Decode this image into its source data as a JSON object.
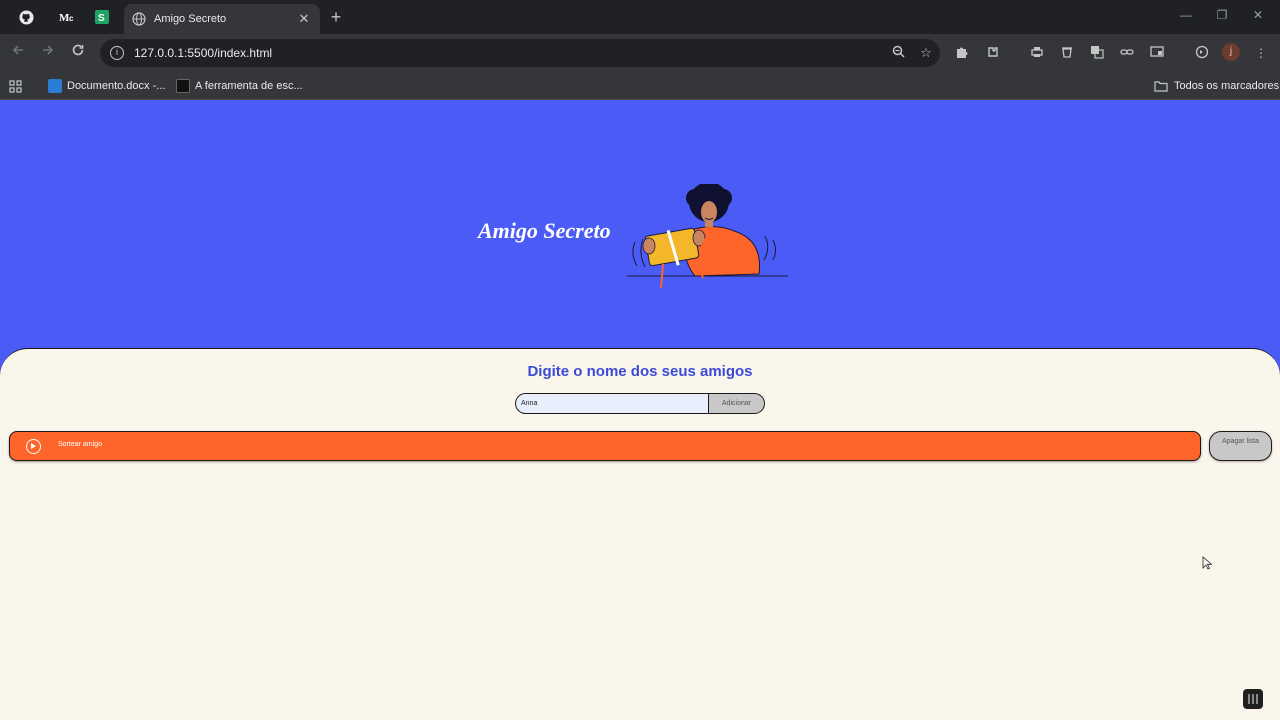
{
  "browser": {
    "tab": {
      "title": "Amigo Secreto",
      "close": "✕"
    },
    "new_tab": "+",
    "pinned": [
      {
        "name": "github",
        "glyph": "●"
      },
      {
        "name": "medium",
        "glyph": "M"
      },
      {
        "name": "sheets",
        "glyph": "[S]"
      }
    ],
    "window": {
      "minimize": "—",
      "maximize": "❐",
      "close": "✕"
    },
    "url": "127.0.0.1:5500/index.html",
    "profile_initial": "j",
    "bookmarks": [
      {
        "label": "Documento.docx -...",
        "color": "#2b7cd3"
      },
      {
        "label": "A ferramenta de esc...",
        "color": "#111111"
      }
    ],
    "all_bookmarks": "Todos os marcadores"
  },
  "page": {
    "title": "Amigo Secreto",
    "subtitle": "Digite o nome dos seus amigos",
    "name_input": {
      "value": "Anna"
    },
    "add_button": "Adicionar",
    "draw_button": "Sortear amigo",
    "clear_button": "Apagar lista",
    "colors": {
      "hero_bg": "#4b5bf5",
      "panel_bg": "#fbf6ec",
      "accent_orange": "#fe652b",
      "subtitle_blue": "#3b4ad8"
    }
  }
}
